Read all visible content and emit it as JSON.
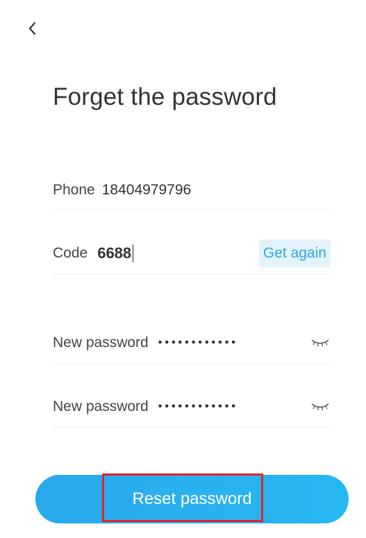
{
  "header": {
    "title": "Forget the password"
  },
  "form": {
    "phone": {
      "label": "Phone",
      "value": "18404979796"
    },
    "code": {
      "label": "Code",
      "value": "6688",
      "action_label": "Get again"
    },
    "new_password_1": {
      "label": "New password",
      "masked_value": "••••••••••••"
    },
    "new_password_2": {
      "label": "New password",
      "masked_value": "••••••••••••"
    }
  },
  "actions": {
    "reset_label": "Reset password"
  },
  "colors": {
    "accent": "#2ea6e6",
    "button": "#28a9ec",
    "highlight": "#e3232c"
  },
  "icons": {
    "back": "chevron-left-icon",
    "eye": "eye-closed-icon"
  }
}
